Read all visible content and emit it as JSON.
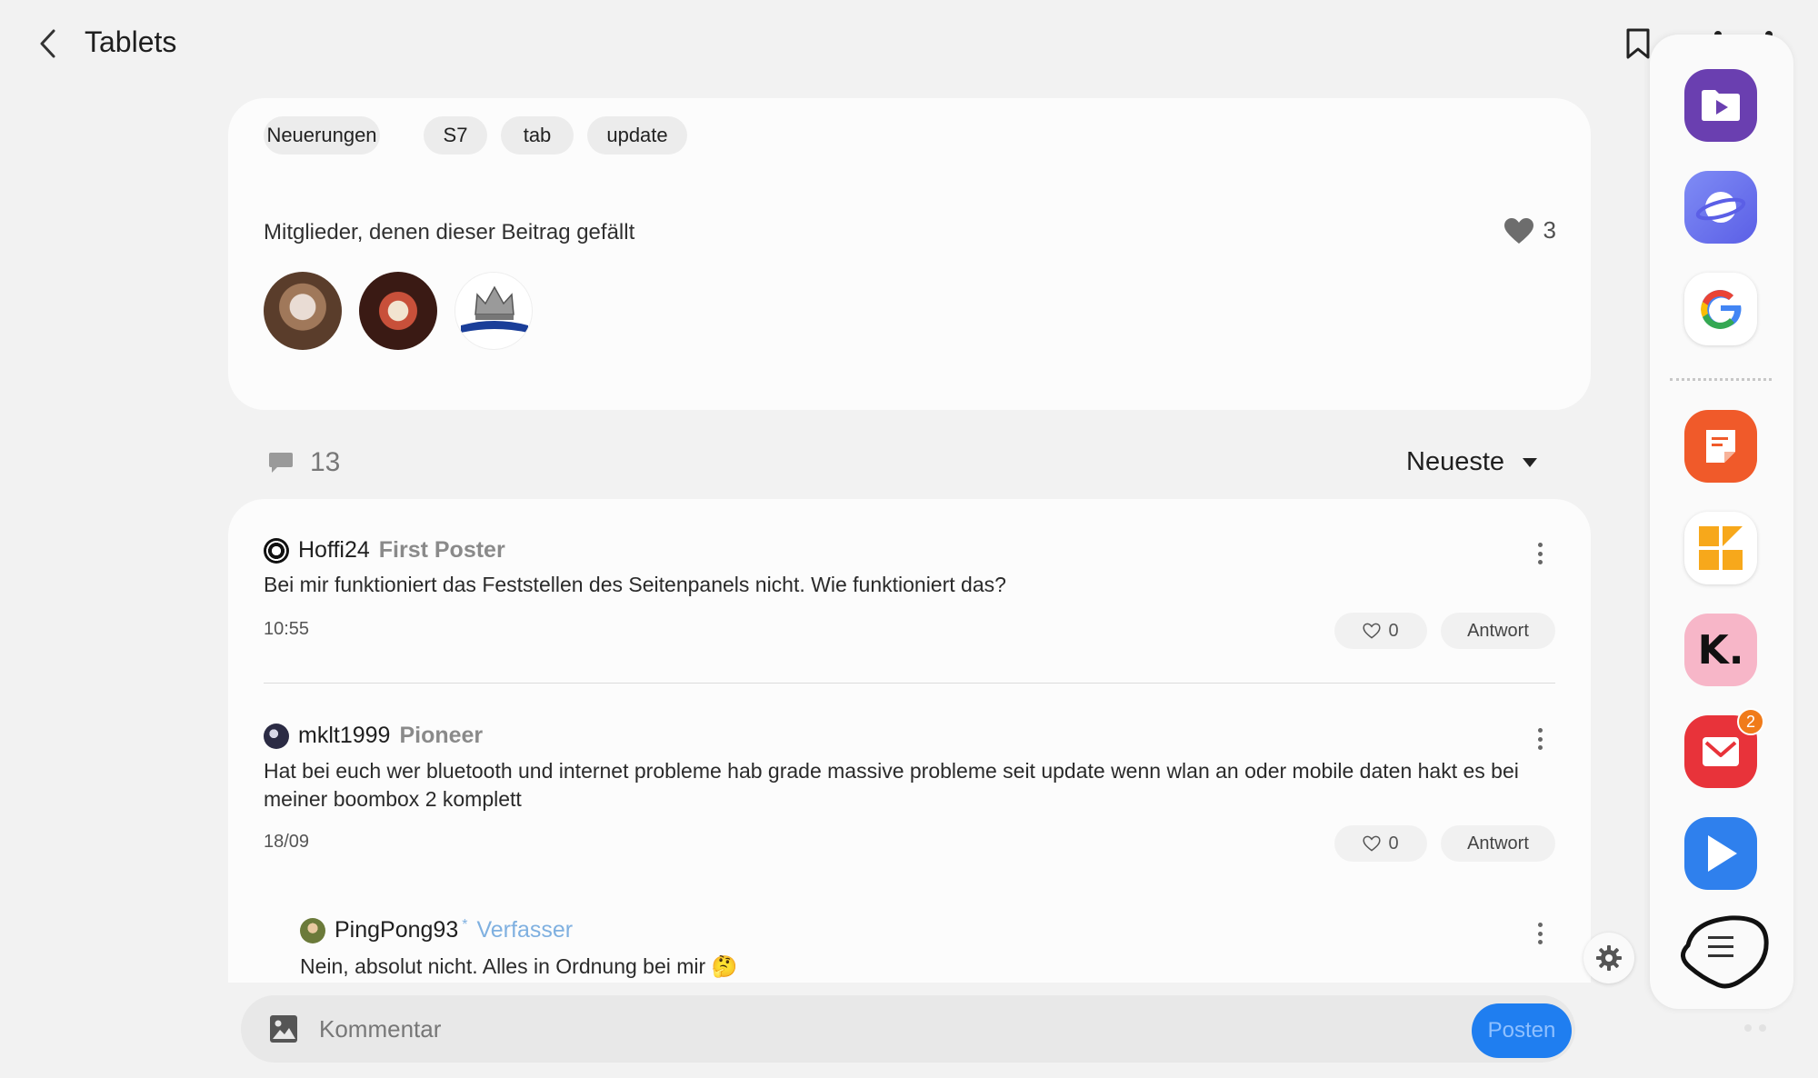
{
  "header": {
    "title": "Tablets",
    "back_icon": "chevron-left-icon",
    "bookmark_icon": "bookmark-icon"
  },
  "tags": [
    "Neuerungen",
    "S7",
    "tab",
    "update"
  ],
  "likes": {
    "label": "Mitglieder, denen dieser Beitrag gefällt",
    "count": "3"
  },
  "comments_header": {
    "count": "13",
    "sort_label": "Neueste"
  },
  "comments": [
    {
      "author": "Hoffi24",
      "rank": "First Poster",
      "text": "Bei mir funktioniert das Feststellen des Seitenpanels nicht. Wie funktioniert das?",
      "time": "10:55",
      "likes": "0",
      "reply_label": "Antwort"
    },
    {
      "author": "mklt1999",
      "rank": "Pioneer",
      "text": "Hat bei euch wer bluetooth und internet probleme hab grade massive probleme seit update wenn wlan an oder mobile daten hakt es bei meiner boombox 2 komplett",
      "time": "18/09",
      "likes": "0",
      "reply_label": "Antwort"
    },
    {
      "author": "PingPong93",
      "author_mark": "*",
      "rank": "Verfasser",
      "text": "Nein, absolut nicht. Alles in Ordnung bei mir 🤔"
    }
  ],
  "composer": {
    "placeholder": "Kommentar",
    "post_label": "Posten"
  },
  "edge_panel": {
    "apps": [
      {
        "name": "video-player-icon",
        "color": "#6a3fb0"
      },
      {
        "name": "browser-icon",
        "color": "#6b6ff0"
      },
      {
        "name": "google-icon",
        "color": "#ffffff"
      },
      {
        "name": "notes-icon",
        "color": "#f05a2a"
      },
      {
        "name": "grid-app-icon",
        "color": "#ffffff"
      },
      {
        "name": "klarna-icon",
        "color": "#f7b6c8"
      },
      {
        "name": "mail-icon",
        "color": "#e8333a",
        "badge": "2"
      },
      {
        "name": "play-icon",
        "color": "#2f80ed"
      }
    ],
    "menu_icon": "menu-icon"
  },
  "colors": {
    "accent": "#1f7ef0",
    "background": "#f2f2f2",
    "card": "#fcfcfc"
  }
}
